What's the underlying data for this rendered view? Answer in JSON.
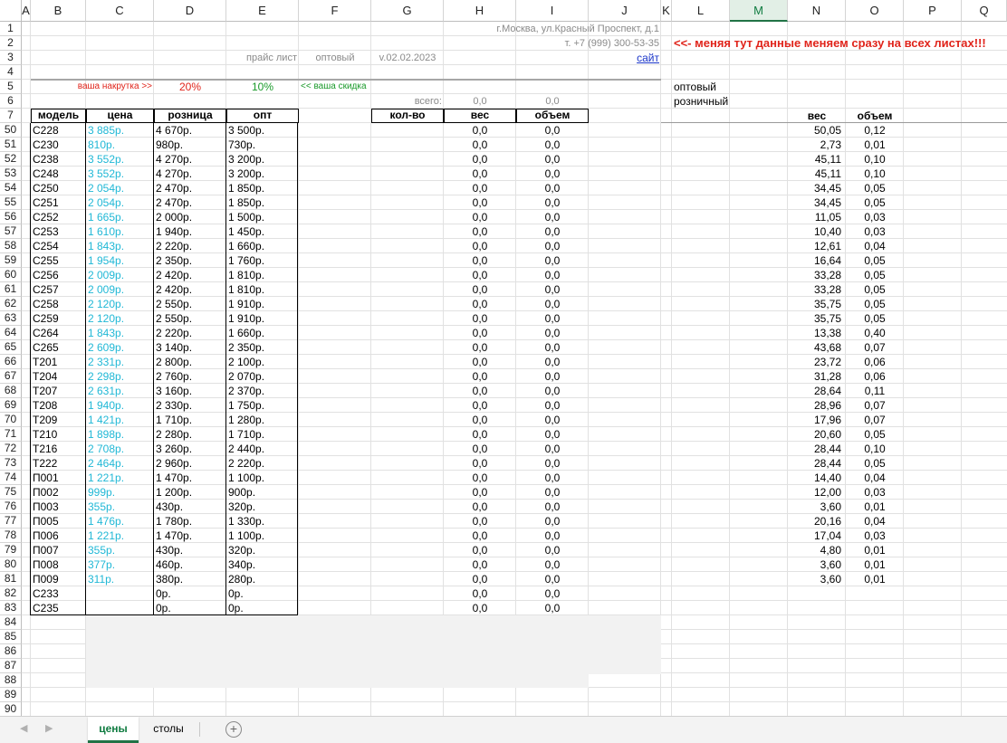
{
  "columns": [
    "A",
    "B",
    "C",
    "D",
    "E",
    "F",
    "G",
    "H",
    "I",
    "J",
    "K",
    "L",
    "M",
    "N",
    "O",
    "P",
    "Q"
  ],
  "selected_column": "M",
  "row_numbers": [
    "1",
    "2",
    "3",
    "4",
    "5",
    "6",
    "7",
    "50",
    "51",
    "52",
    "53",
    "54",
    "55",
    "56",
    "57",
    "58",
    "59",
    "60",
    "61",
    "62",
    "63",
    "64",
    "65",
    "66",
    "67",
    "68",
    "69",
    "70",
    "71",
    "72",
    "73",
    "74",
    "75",
    "76",
    "77",
    "78",
    "79",
    "80",
    "81",
    "82",
    "83",
    "84",
    "85",
    "86",
    "87",
    "88",
    "89",
    "90"
  ],
  "header": {
    "address": "г.Москва, ул.Красный Проспект, д.1",
    "phone": "т. +7 (999) 300-53-35",
    "price_list": "прайс лист",
    "price_type": "оптовый",
    "version": "v.02.02.2023",
    "site_link": "сайт",
    "warning": "<<- меняя тут данные меняем сразу на всех листах!!!",
    "markup_label": "ваша накрутка >>",
    "markup_value": "20%",
    "discount_value": "10%",
    "discount_label": "<< ваша скидка",
    "option_wholesale": "оптовый",
    "option_retail": "розничный",
    "total_label": "всего:",
    "total_weight": "0,0",
    "total_volume": "0,0"
  },
  "table_headers": {
    "model": "модель",
    "price": "цена",
    "retail": "розница",
    "wholesale": "опт",
    "qty": "кол-во",
    "weight": "вес",
    "volume": "объем",
    "n_weight": "вес",
    "n_volume": "объем"
  },
  "rows": [
    {
      "model": "С228",
      "price": "3 885р.",
      "retail": "4 670р.",
      "opt": "3 500р.",
      "w": "0,0",
      "v": "0,0",
      "nw": "50,05",
      "nv": "0,12"
    },
    {
      "model": "С230",
      "price": "810р.",
      "retail": "980р.",
      "opt": "730р.",
      "w": "0,0",
      "v": "0,0",
      "nw": "2,73",
      "nv": "0,01"
    },
    {
      "model": "С238",
      "price": "3 552р.",
      "retail": "4 270р.",
      "opt": "3 200р.",
      "w": "0,0",
      "v": "0,0",
      "nw": "45,11",
      "nv": "0,10"
    },
    {
      "model": "С248",
      "price": "3 552р.",
      "retail": "4 270р.",
      "opt": "3 200р.",
      "w": "0,0",
      "v": "0,0",
      "nw": "45,11",
      "nv": "0,10"
    },
    {
      "model": "С250",
      "price": "2 054р.",
      "retail": "2 470р.",
      "opt": "1 850р.",
      "w": "0,0",
      "v": "0,0",
      "nw": "34,45",
      "nv": "0,05"
    },
    {
      "model": "С251",
      "price": "2 054р.",
      "retail": "2 470р.",
      "opt": "1 850р.",
      "w": "0,0",
      "v": "0,0",
      "nw": "34,45",
      "nv": "0,05"
    },
    {
      "model": "С252",
      "price": "1 665р.",
      "retail": "2 000р.",
      "opt": "1 500р.",
      "w": "0,0",
      "v": "0,0",
      "nw": "11,05",
      "nv": "0,03"
    },
    {
      "model": "С253",
      "price": "1 610р.",
      "retail": "1 940р.",
      "opt": "1 450р.",
      "w": "0,0",
      "v": "0,0",
      "nw": "10,40",
      "nv": "0,03"
    },
    {
      "model": "С254",
      "price": "1 843р.",
      "retail": "2 220р.",
      "opt": "1 660р.",
      "w": "0,0",
      "v": "0,0",
      "nw": "12,61",
      "nv": "0,04"
    },
    {
      "model": "С255",
      "price": "1 954р.",
      "retail": "2 350р.",
      "opt": "1 760р.",
      "w": "0,0",
      "v": "0,0",
      "nw": "16,64",
      "nv": "0,05"
    },
    {
      "model": "С256",
      "price": "2 009р.",
      "retail": "2 420р.",
      "opt": "1 810р.",
      "w": "0,0",
      "v": "0,0",
      "nw": "33,28",
      "nv": "0,05"
    },
    {
      "model": "С257",
      "price": "2 009р.",
      "retail": "2 420р.",
      "opt": "1 810р.",
      "w": "0,0",
      "v": "0,0",
      "nw": "33,28",
      "nv": "0,05"
    },
    {
      "model": "С258",
      "price": "2 120р.",
      "retail": "2 550р.",
      "opt": "1 910р.",
      "w": "0,0",
      "v": "0,0",
      "nw": "35,75",
      "nv": "0,05"
    },
    {
      "model": "С259",
      "price": "2 120р.",
      "retail": "2 550р.",
      "opt": "1 910р.",
      "w": "0,0",
      "v": "0,0",
      "nw": "35,75",
      "nv": "0,05"
    },
    {
      "model": "С264",
      "price": "1 843р.",
      "retail": "2 220р.",
      "opt": "1 660р.",
      "w": "0,0",
      "v": "0,0",
      "nw": "13,38",
      "nv": "0,40"
    },
    {
      "model": "С265",
      "price": "2 609р.",
      "retail": "3 140р.",
      "opt": "2 350р.",
      "w": "0,0",
      "v": "0,0",
      "nw": "43,68",
      "nv": "0,07"
    },
    {
      "model": "Т201",
      "price": "2 331р.",
      "retail": "2 800р.",
      "opt": "2 100р.",
      "w": "0,0",
      "v": "0,0",
      "nw": "23,72",
      "nv": "0,06"
    },
    {
      "model": "Т204",
      "price": "2 298р.",
      "retail": "2 760р.",
      "opt": "2 070р.",
      "w": "0,0",
      "v": "0,0",
      "nw": "31,28",
      "nv": "0,06"
    },
    {
      "model": "Т207",
      "price": "2 631р.",
      "retail": "3 160р.",
      "opt": "2 370р.",
      "w": "0,0",
      "v": "0,0",
      "nw": "28,64",
      "nv": "0,11"
    },
    {
      "model": "Т208",
      "price": "1 940р.",
      "retail": "2 330р.",
      "opt": "1 750р.",
      "w": "0,0",
      "v": "0,0",
      "nw": "28,96",
      "nv": "0,07"
    },
    {
      "model": "Т209",
      "price": "1 421р.",
      "retail": "1 710р.",
      "opt": "1 280р.",
      "w": "0,0",
      "v": "0,0",
      "nw": "17,96",
      "nv": "0,07"
    },
    {
      "model": "Т210",
      "price": "1 898р.",
      "retail": "2 280р.",
      "opt": "1 710р.",
      "w": "0,0",
      "v": "0,0",
      "nw": "20,60",
      "nv": "0,05"
    },
    {
      "model": "Т216",
      "price": "2 708р.",
      "retail": "3 260р.",
      "opt": "2 440р.",
      "w": "0,0",
      "v": "0,0",
      "nw": "28,44",
      "nv": "0,10"
    },
    {
      "model": "Т222",
      "price": "2 464р.",
      "retail": "2 960р.",
      "opt": "2 220р.",
      "w": "0,0",
      "v": "0,0",
      "nw": "28,44",
      "nv": "0,05"
    },
    {
      "model": "П001",
      "price": "1 221р.",
      "retail": "1 470р.",
      "opt": "1 100р.",
      "w": "0,0",
      "v": "0,0",
      "nw": "14,40",
      "nv": "0,04"
    },
    {
      "model": "П002",
      "price": "999р.",
      "retail": "1 200р.",
      "opt": "900р.",
      "w": "0,0",
      "v": "0,0",
      "nw": "12,00",
      "nv": "0,03"
    },
    {
      "model": "П003",
      "price": "355р.",
      "retail": "430р.",
      "opt": "320р.",
      "w": "0,0",
      "v": "0,0",
      "nw": "3,60",
      "nv": "0,01"
    },
    {
      "model": "П005",
      "price": "1 476р.",
      "retail": "1 780р.",
      "opt": "1 330р.",
      "w": "0,0",
      "v": "0,0",
      "nw": "20,16",
      "nv": "0,04"
    },
    {
      "model": "П006",
      "price": "1 221р.",
      "retail": "1 470р.",
      "opt": "1 100р.",
      "w": "0,0",
      "v": "0,0",
      "nw": "17,04",
      "nv": "0,03"
    },
    {
      "model": "П007",
      "price": "355р.",
      "retail": "430р.",
      "opt": "320р.",
      "w": "0,0",
      "v": "0,0",
      "nw": "4,80",
      "nv": "0,01"
    },
    {
      "model": "П008",
      "price": "377р.",
      "retail": "460р.",
      "opt": "340р.",
      "w": "0,0",
      "v": "0,0",
      "nw": "3,60",
      "nv": "0,01"
    },
    {
      "model": "П009",
      "price": "311р.",
      "retail": "380р.",
      "opt": "280р.",
      "w": "0,0",
      "v": "0,0",
      "nw": "3,60",
      "nv": "0,01"
    },
    {
      "model": "С233",
      "price": "",
      "retail": "0р.",
      "opt": "0р.",
      "w": "0,0",
      "v": "0,0",
      "nw": "",
      "nv": ""
    },
    {
      "model": "С235",
      "price": "",
      "retail": "0р.",
      "opt": "0р.",
      "w": "0,0",
      "v": "0,0",
      "nw": "",
      "nv": ""
    }
  ],
  "sheet_tabs": {
    "active": "цены",
    "other": "столы",
    "add": "+"
  },
  "colors": {
    "accent": "#217346",
    "price_cyan": "#21b8d6",
    "warning_red": "#e0241b",
    "discount_green": "#1a9a2a"
  }
}
